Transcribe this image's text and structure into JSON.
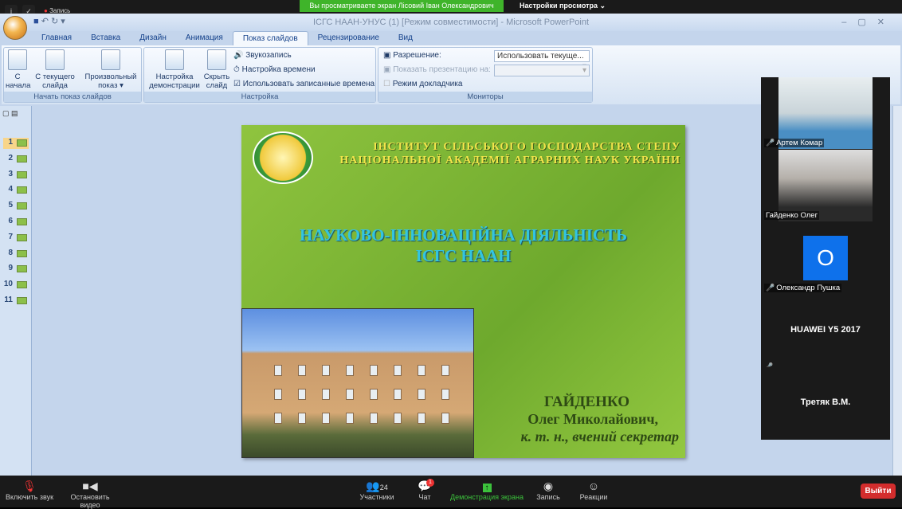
{
  "zoom_top": {
    "banner": "Вы просматриваете экран Лісовий Іван Олександрович",
    "view_options": "Настройки просмотра ⌄",
    "recording": "Запись"
  },
  "ppt": {
    "title": "ІСГС НААН-УНУС (1) [Режим совместимости] - Microsoft PowerPoint",
    "tabs": [
      "Главная",
      "Вставка",
      "Дизайн",
      "Анимация",
      "Показ слайдов",
      "Рецензирование",
      "Вид"
    ],
    "groups": {
      "start": "Начать показ слайдов",
      "setup": "Настройка",
      "monitors": "Мониторы"
    },
    "buttons": {
      "from_start": "С\nначала",
      "from_current": "С текущего\nслайда",
      "custom": "Произвольный\nпоказ ▾",
      "setup_show": "Настройка\nдемонстрации",
      "hide_slide": "Скрыть\nслайд",
      "record": "Звукозапись",
      "rehearse": "Настройка времени",
      "use_timings": "Использовать записанные времена",
      "resolution": "Разрешение:",
      "show_on": "Показать презентацию на:",
      "presenter": "Режим докладчика"
    },
    "resolution_value": "Использовать текуще...",
    "slides": [
      "1",
      "2",
      "3",
      "4",
      "5",
      "6",
      "7",
      "8",
      "9",
      "10",
      "11"
    ]
  },
  "slide": {
    "header1": "ІНСТИТУТ СІЛЬСЬКОГО ГОСПОДАРСТВА СТЕПУ",
    "header2": "НАЦІОНАЛЬНОЇ АКАДЕМІЇ АГРАРНИХ НАУК УКРАЇНИ",
    "title1": "НАУКОВО-ІННОВАЦІЙНА ДІЯЛЬНІСТЬ",
    "title2": "ІСГС НААН",
    "name1": "ГАЙДЕНКО",
    "name2": "Олег Миколайович,",
    "name3": "к. т. н., вчений секретар"
  },
  "participants": [
    {
      "name": "Артем Комар"
    },
    {
      "name": "Гайденко Олег"
    },
    {
      "name": "Олександр Пушка",
      "initial": "О"
    },
    {
      "name": "HUAWEI Y5 2017"
    },
    {
      "name": "Третяк В.М."
    }
  ],
  "toolbar": {
    "unmute": "Включить звук",
    "stop_video": "Остановить видео",
    "participants": "Участники",
    "participants_count": "24",
    "chat": "Чат",
    "chat_badge": "1",
    "share": "Демонстрация экрана",
    "record": "Запись",
    "reactions": "Реакции",
    "leave": "Выйти"
  }
}
